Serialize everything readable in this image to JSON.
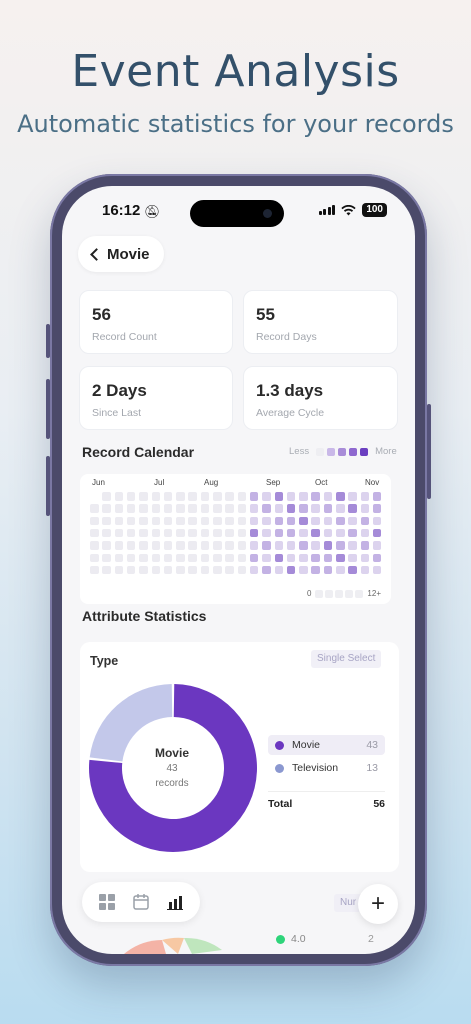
{
  "promo": {
    "title": "Event Analysis",
    "subtitle": "Automatic statistics for your records"
  },
  "status_bar": {
    "time": "16:12",
    "battery": "100"
  },
  "nav": {
    "back_label": "Movie"
  },
  "stats": [
    {
      "value": "56",
      "label": "Record Count"
    },
    {
      "value": "55",
      "label": "Record Days"
    },
    {
      "value": "2 Days",
      "label": "Since Last"
    },
    {
      "value": "1.3 days",
      "label": "Average Cycle"
    }
  ],
  "calendar": {
    "title": "Record Calendar",
    "legend_less": "Less",
    "legend_more": "More",
    "months": [
      "Jun",
      "Jul",
      "Aug",
      "Sep",
      "Oct",
      "Nov"
    ],
    "scale_min": "0",
    "scale_max": "12+",
    "colors": {
      "empty": "#ecebf1",
      "light": "#dcd3ee",
      "mid": "#c3b2e4",
      "strong": "#a58bd8",
      "dark": "#7b52c7"
    }
  },
  "attributes": {
    "title": "Attribute Statistics",
    "type_label": "Type",
    "select_mode": "Single Select",
    "center_title": "Movie",
    "center_count": "43",
    "center_unit": "records",
    "items": [
      {
        "name": "Movie",
        "count": "43",
        "color": "#6b37c0"
      },
      {
        "name": "Television",
        "count": "13",
        "color": "#8b98d0"
      }
    ],
    "total_label": "Total",
    "total_value": "56"
  },
  "chart_data": {
    "type": "pie",
    "categories": [
      "Movie",
      "Television"
    ],
    "values": [
      43,
      13
    ],
    "colors": [
      "#6b37c0",
      "#c3c8ea"
    ]
  },
  "peek": {
    "chip": "Nur",
    "value": "4.0",
    "count": "2"
  }
}
